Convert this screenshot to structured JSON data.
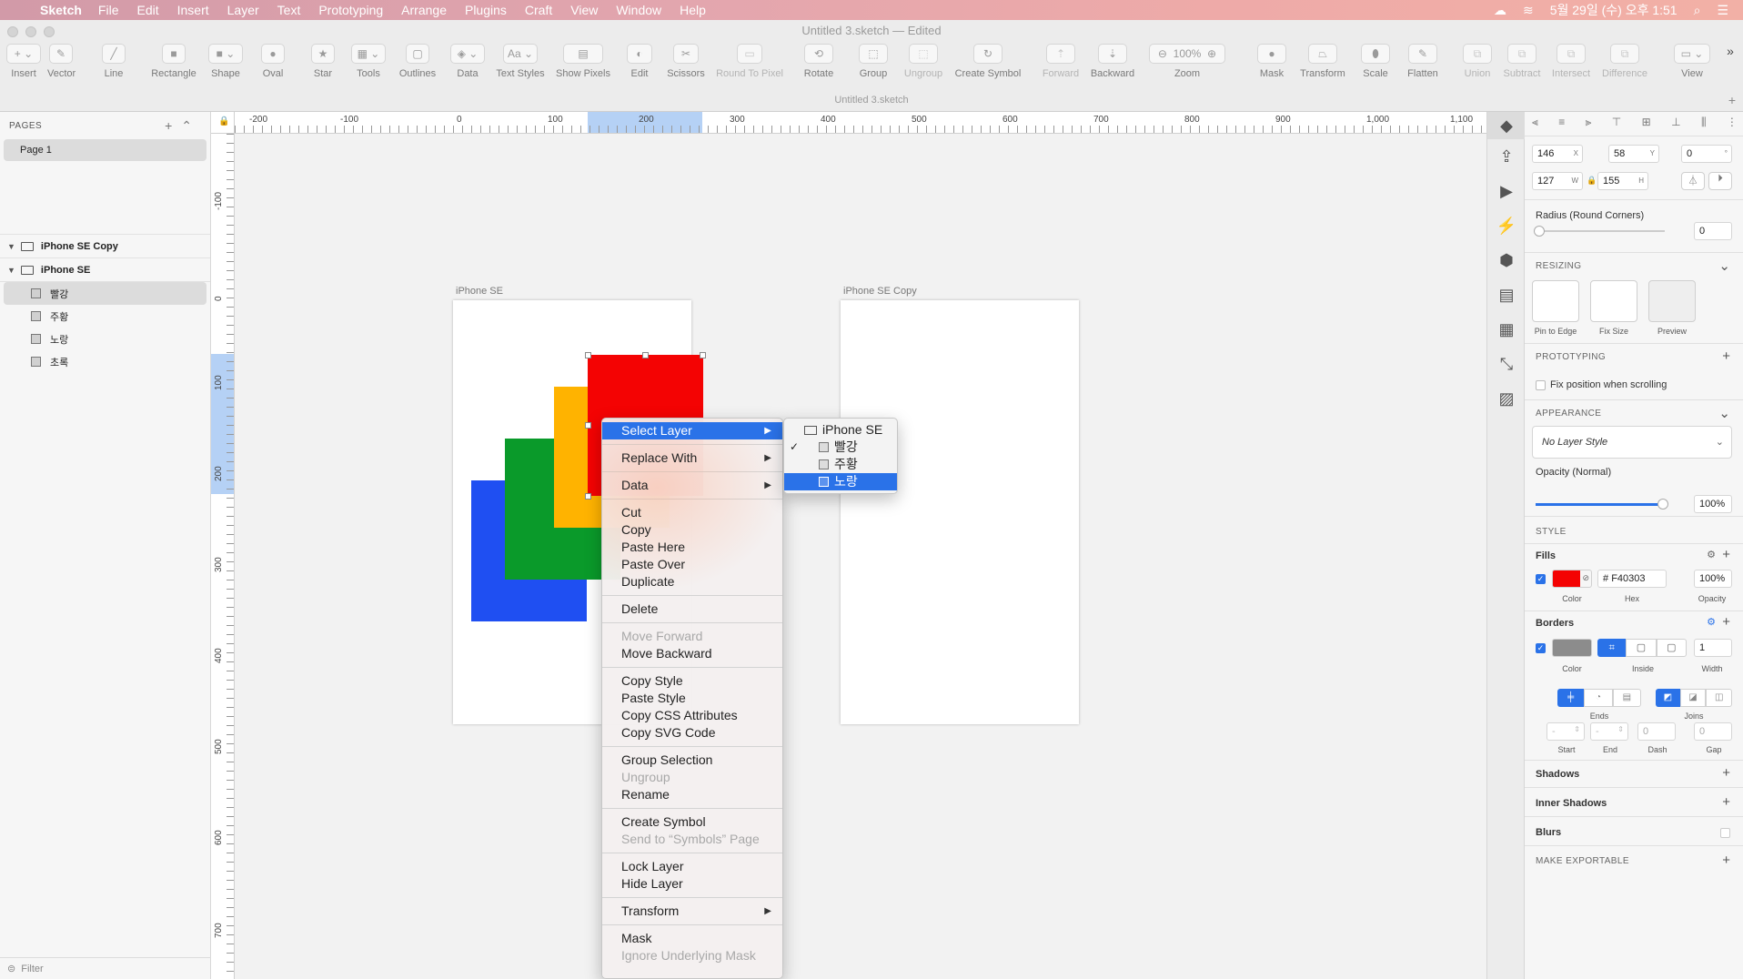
{
  "menubar": {
    "app": "Sketch",
    "items": [
      "File",
      "Edit",
      "Insert",
      "Layer",
      "Text",
      "Prototyping",
      "Arrange",
      "Plugins",
      "Craft",
      "View",
      "Window",
      "Help"
    ],
    "clock": "5월 29일 (수) 오후 1:51"
  },
  "window": {
    "title": "Untitled 3.sketch — Edited",
    "doc_tab": "Untitled 3.sketch"
  },
  "toolbar": {
    "insert": "Insert",
    "vector": "Vector",
    "line": "Line",
    "rectangle": "Rectangle",
    "shape": "Shape",
    "oval": "Oval",
    "star": "Star",
    "tools": "Tools",
    "outlines": "Outlines",
    "data": "Data",
    "text_styles": "Text Styles",
    "show_pixels": "Show Pixels",
    "edit": "Edit",
    "scissors": "Scissors",
    "round_to_pixel": "Round To Pixel",
    "rotate": "Rotate",
    "group": "Group",
    "ungroup": "Ungroup",
    "create_symbol": "Create Symbol",
    "forward": "Forward",
    "backward": "Backward",
    "zoom": "Zoom",
    "zoom_value": "100%",
    "mask": "Mask",
    "transform": "Transform",
    "scale": "Scale",
    "flatten": "Flatten",
    "union": "Union",
    "subtract": "Subtract",
    "intersect": "Intersect",
    "difference": "Difference",
    "view": "View",
    "text_style_glyph": "Aa"
  },
  "pages": {
    "header": "PAGES",
    "items": [
      "Page 1"
    ]
  },
  "layers": {
    "artboards": [
      "iPhone SE Copy",
      "iPhone SE"
    ],
    "children": [
      "빨강",
      "주황",
      "노랑",
      "초록"
    ],
    "filter": "Filter"
  },
  "ruler": {
    "h_labels": [
      "-200",
      "-100",
      "0",
      "100",
      "200",
      "300",
      "400",
      "500",
      "600",
      "700",
      "800",
      "900",
      "1,000",
      "1,100"
    ],
    "v_labels": [
      "-100",
      "0",
      "100",
      "200",
      "300",
      "400",
      "500",
      "600",
      "700"
    ]
  },
  "canvas": {
    "artboard1": "iPhone SE",
    "artboard2": "iPhone SE Copy",
    "colors": {
      "red": "#f40303",
      "orange": "#ffb300",
      "green": "#0a9a2a",
      "blue": "#1f4ff2"
    }
  },
  "context_menu": {
    "select_layer": "Select Layer",
    "replace_with": "Replace With",
    "data": "Data",
    "cut": "Cut",
    "copy": "Copy",
    "paste_here": "Paste Here",
    "paste_over": "Paste Over",
    "duplicate": "Duplicate",
    "delete": "Delete",
    "move_forward": "Move Forward",
    "move_backward": "Move Backward",
    "copy_style": "Copy Style",
    "paste_style": "Paste Style",
    "copy_css": "Copy CSS Attributes",
    "copy_svg": "Copy SVG Code",
    "group_selection": "Group Selection",
    "ungroup": "Ungroup",
    "rename": "Rename",
    "create_symbol": "Create Symbol",
    "send_to_symbols": "Send to “Symbols” Page",
    "lock_layer": "Lock Layer",
    "hide_layer": "Hide Layer",
    "transform": "Transform",
    "mask": "Mask",
    "ignore_mask": "Ignore Underlying Mask"
  },
  "submenu": {
    "items": [
      "iPhone SE",
      "빨강",
      "주황",
      "노랑"
    ]
  },
  "inspector": {
    "x": "146",
    "y": "58",
    "rot": "0",
    "w": "127",
    "h": "155",
    "x_unit": "X",
    "y_unit": "Y",
    "w_unit": "W",
    "h_unit": "H",
    "rot_unit": "°",
    "radius_label": "Radius (Round Corners)",
    "radius_value": "0",
    "resizing": "RESIZING",
    "pin_to_edge": "Pin to Edge",
    "fix_size": "Fix Size",
    "preview": "Preview",
    "prototyping": "PROTOTYPING",
    "fix_position": "Fix position when scrolling",
    "appearance": "APPEARANCE",
    "layer_style": "No Layer Style",
    "opacity_label": "Opacity (Normal)",
    "opacity_value": "100%",
    "style": "STYLE",
    "fills": "Fills",
    "fill_hex": "F40303",
    "fill_opacity": "100%",
    "fill_color": "#f40303",
    "color_cap": "Color",
    "hex_cap": "Hex",
    "opacity_cap": "Opacity",
    "borders": "Borders",
    "border_width": "1",
    "inside_cap": "Inside",
    "width_cap": "Width",
    "ends_cap": "Ends",
    "joins_cap": "Joins",
    "start_cap": "Start",
    "end_cap": "End",
    "dash_cap": "Dash",
    "gap_cap": "Gap",
    "dash_value": "0",
    "gap_value": "0",
    "shadows": "Shadows",
    "inner_shadows": "Inner Shadows",
    "blurs": "Blurs",
    "make_exportable": "MAKE EXPORTABLE"
  }
}
